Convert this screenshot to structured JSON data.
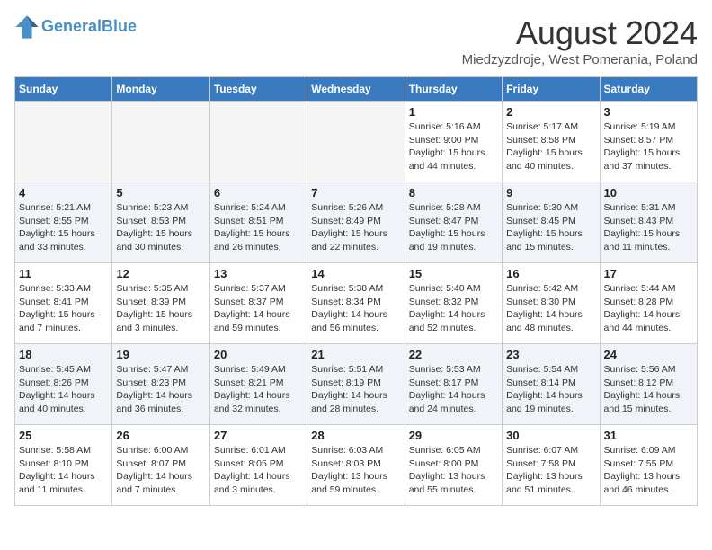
{
  "header": {
    "logo_line1": "General",
    "logo_line2": "Blue",
    "month_title": "August 2024",
    "subtitle": "Miedzyzdroje, West Pomerania, Poland"
  },
  "weekdays": [
    "Sunday",
    "Monday",
    "Tuesday",
    "Wednesday",
    "Thursday",
    "Friday",
    "Saturday"
  ],
  "weeks": [
    [
      {
        "day": "",
        "empty": true
      },
      {
        "day": "",
        "empty": true
      },
      {
        "day": "",
        "empty": true
      },
      {
        "day": "",
        "empty": true
      },
      {
        "day": "1",
        "info": "Sunrise: 5:16 AM\nSunset: 9:00 PM\nDaylight: 15 hours\nand 44 minutes."
      },
      {
        "day": "2",
        "info": "Sunrise: 5:17 AM\nSunset: 8:58 PM\nDaylight: 15 hours\nand 40 minutes."
      },
      {
        "day": "3",
        "info": "Sunrise: 5:19 AM\nSunset: 8:57 PM\nDaylight: 15 hours\nand 37 minutes."
      }
    ],
    [
      {
        "day": "4",
        "info": "Sunrise: 5:21 AM\nSunset: 8:55 PM\nDaylight: 15 hours\nand 33 minutes."
      },
      {
        "day": "5",
        "info": "Sunrise: 5:23 AM\nSunset: 8:53 PM\nDaylight: 15 hours\nand 30 minutes."
      },
      {
        "day": "6",
        "info": "Sunrise: 5:24 AM\nSunset: 8:51 PM\nDaylight: 15 hours\nand 26 minutes."
      },
      {
        "day": "7",
        "info": "Sunrise: 5:26 AM\nSunset: 8:49 PM\nDaylight: 15 hours\nand 22 minutes."
      },
      {
        "day": "8",
        "info": "Sunrise: 5:28 AM\nSunset: 8:47 PM\nDaylight: 15 hours\nand 19 minutes."
      },
      {
        "day": "9",
        "info": "Sunrise: 5:30 AM\nSunset: 8:45 PM\nDaylight: 15 hours\nand 15 minutes."
      },
      {
        "day": "10",
        "info": "Sunrise: 5:31 AM\nSunset: 8:43 PM\nDaylight: 15 hours\nand 11 minutes."
      }
    ],
    [
      {
        "day": "11",
        "info": "Sunrise: 5:33 AM\nSunset: 8:41 PM\nDaylight: 15 hours\nand 7 minutes."
      },
      {
        "day": "12",
        "info": "Sunrise: 5:35 AM\nSunset: 8:39 PM\nDaylight: 15 hours\nand 3 minutes."
      },
      {
        "day": "13",
        "info": "Sunrise: 5:37 AM\nSunset: 8:37 PM\nDaylight: 14 hours\nand 59 minutes."
      },
      {
        "day": "14",
        "info": "Sunrise: 5:38 AM\nSunset: 8:34 PM\nDaylight: 14 hours\nand 56 minutes."
      },
      {
        "day": "15",
        "info": "Sunrise: 5:40 AM\nSunset: 8:32 PM\nDaylight: 14 hours\nand 52 minutes."
      },
      {
        "day": "16",
        "info": "Sunrise: 5:42 AM\nSunset: 8:30 PM\nDaylight: 14 hours\nand 48 minutes."
      },
      {
        "day": "17",
        "info": "Sunrise: 5:44 AM\nSunset: 8:28 PM\nDaylight: 14 hours\nand 44 minutes."
      }
    ],
    [
      {
        "day": "18",
        "info": "Sunrise: 5:45 AM\nSunset: 8:26 PM\nDaylight: 14 hours\nand 40 minutes."
      },
      {
        "day": "19",
        "info": "Sunrise: 5:47 AM\nSunset: 8:23 PM\nDaylight: 14 hours\nand 36 minutes."
      },
      {
        "day": "20",
        "info": "Sunrise: 5:49 AM\nSunset: 8:21 PM\nDaylight: 14 hours\nand 32 minutes."
      },
      {
        "day": "21",
        "info": "Sunrise: 5:51 AM\nSunset: 8:19 PM\nDaylight: 14 hours\nand 28 minutes."
      },
      {
        "day": "22",
        "info": "Sunrise: 5:53 AM\nSunset: 8:17 PM\nDaylight: 14 hours\nand 24 minutes."
      },
      {
        "day": "23",
        "info": "Sunrise: 5:54 AM\nSunset: 8:14 PM\nDaylight: 14 hours\nand 19 minutes."
      },
      {
        "day": "24",
        "info": "Sunrise: 5:56 AM\nSunset: 8:12 PM\nDaylight: 14 hours\nand 15 minutes."
      }
    ],
    [
      {
        "day": "25",
        "info": "Sunrise: 5:58 AM\nSunset: 8:10 PM\nDaylight: 14 hours\nand 11 minutes."
      },
      {
        "day": "26",
        "info": "Sunrise: 6:00 AM\nSunset: 8:07 PM\nDaylight: 14 hours\nand 7 minutes."
      },
      {
        "day": "27",
        "info": "Sunrise: 6:01 AM\nSunset: 8:05 PM\nDaylight: 14 hours\nand 3 minutes."
      },
      {
        "day": "28",
        "info": "Sunrise: 6:03 AM\nSunset: 8:03 PM\nDaylight: 13 hours\nand 59 minutes."
      },
      {
        "day": "29",
        "info": "Sunrise: 6:05 AM\nSunset: 8:00 PM\nDaylight: 13 hours\nand 55 minutes."
      },
      {
        "day": "30",
        "info": "Sunrise: 6:07 AM\nSunset: 7:58 PM\nDaylight: 13 hours\nand 51 minutes."
      },
      {
        "day": "31",
        "info": "Sunrise: 6:09 AM\nSunset: 7:55 PM\nDaylight: 13 hours\nand 46 minutes."
      }
    ]
  ]
}
